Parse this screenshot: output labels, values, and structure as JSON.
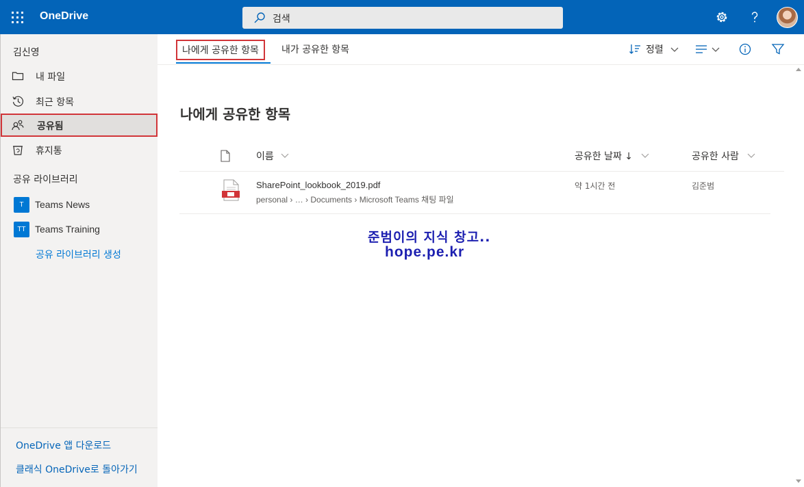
{
  "header": {
    "app_name": "OneDrive",
    "search_placeholder": "검색",
    "accent_color": "#0364b8"
  },
  "sidebar": {
    "user_name": "김신영",
    "items": [
      {
        "label": "내 파일",
        "icon": "folder-icon"
      },
      {
        "label": "최근 항목",
        "icon": "history-icon"
      },
      {
        "label": "공유됨",
        "icon": "people-icon",
        "selected": true
      },
      {
        "label": "휴지통",
        "icon": "recycle-bin-icon"
      }
    ],
    "section_title": "공유 라이브러리",
    "libraries": [
      {
        "badge": "T",
        "label": "Teams News"
      },
      {
        "badge": "TT",
        "label": "Teams Training"
      }
    ],
    "create_library": "공유 라이브러리 생성",
    "footer_links": [
      "OneDrive 앱 다운로드",
      "클래식 OneDrive로 돌아가기"
    ]
  },
  "command_bar": {
    "tabs": [
      {
        "label": "나에게 공유한 항목",
        "active": true
      },
      {
        "label": "내가 공유한 항목",
        "active": false
      }
    ],
    "sort_label": "정렬"
  },
  "main": {
    "title": "나에게 공유한 항목",
    "columns": {
      "name": "이름",
      "shared_date": "공유한 날짜 ↓",
      "shared_by": "공유한 사람"
    },
    "rows": [
      {
        "name": "SharePoint_lookbook_2019.pdf",
        "path": "personal  ›  …  ›  Documents  ›  Microsoft Teams 채팅 파일",
        "shared_date": "약 1시간 전",
        "shared_by": "김준범"
      }
    ],
    "watermark_line1": "준범이의 지식 창고..",
    "watermark_line2": "hope.pe.kr"
  }
}
